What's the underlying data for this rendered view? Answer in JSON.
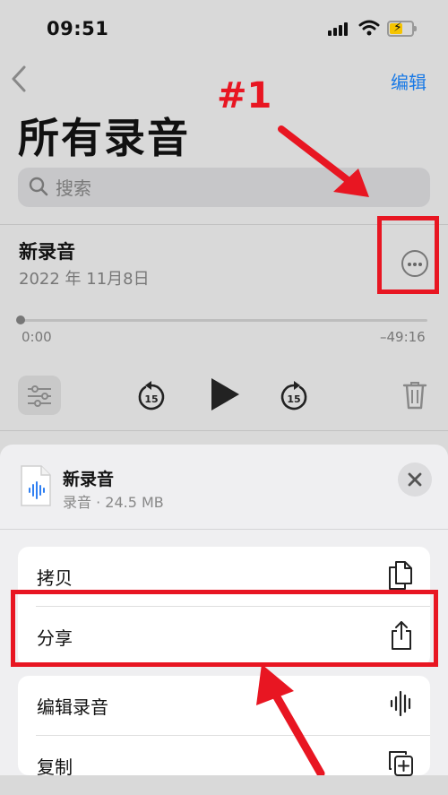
{
  "status_bar": {
    "time": "09:51"
  },
  "header": {
    "edit_label": "编辑",
    "title": "所有录音"
  },
  "search": {
    "placeholder": "搜索"
  },
  "recording": {
    "title": "新录音",
    "date": "2022 年 11月8日",
    "elapsed": "0:00",
    "remaining": "–49:16",
    "progress": 0
  },
  "controls": {
    "skip_back_seconds": "15",
    "skip_forward_seconds": "15"
  },
  "sheet": {
    "title": "新录音",
    "subtitle": "录音 · 24.5 MB",
    "menu": [
      {
        "label": "拷贝",
        "icon": "copy-icon"
      },
      {
        "label": "分享",
        "icon": "share-icon"
      },
      {
        "label": "编辑录音",
        "icon": "waveform-icon"
      },
      {
        "label": "复制",
        "icon": "duplicate-icon"
      }
    ]
  },
  "annotations": {
    "label": "#1",
    "color": "#e81622"
  },
  "colors": {
    "accent": "#1a7ae6",
    "annotation": "#e81622",
    "battery": "#f5c400"
  }
}
